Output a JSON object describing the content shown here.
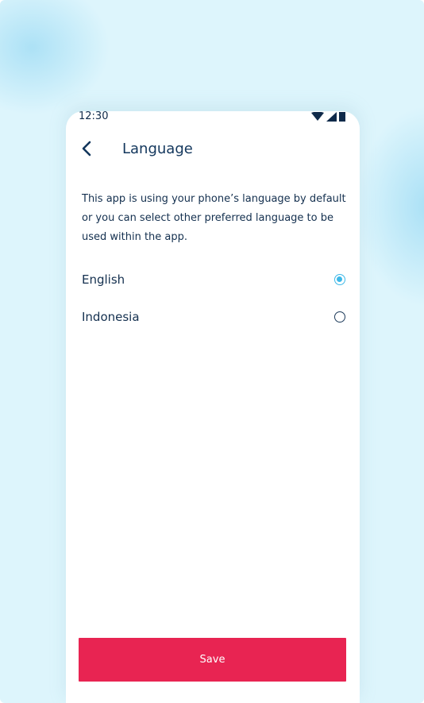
{
  "status_bar": {
    "time": "12:30",
    "icons": [
      "wifi-icon",
      "signal-icon",
      "battery-icon"
    ]
  },
  "header": {
    "back_icon": "chevron-left-icon",
    "title": "Language"
  },
  "description": "This app is using your phone’s language by default or you can select other preferred language to be used within the app.",
  "languages": [
    {
      "label": "English",
      "selected": true
    },
    {
      "label": "Indonesia",
      "selected": false
    }
  ],
  "save_label": "Save",
  "colors": {
    "background": "#ddf5fc",
    "accent_radio": "#3db8e8",
    "primary_text": "#14304f",
    "save_button": "#e82452"
  }
}
